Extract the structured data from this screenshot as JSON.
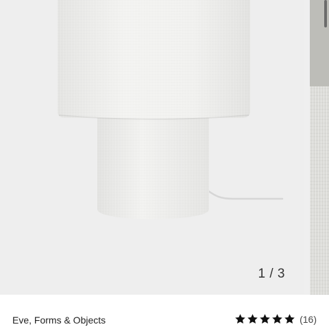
{
  "carousel": {
    "image_alt": "White fabric table lamp",
    "counter": "1 / 3"
  },
  "product": {
    "brand": "Eve, Forms & Objects",
    "rating": 5,
    "review_count": "(16)"
  },
  "colors": {
    "background": "#ffffff",
    "image_bg": "#eeeeee",
    "star": "#111111"
  },
  "icons": {
    "star": "star-icon"
  }
}
